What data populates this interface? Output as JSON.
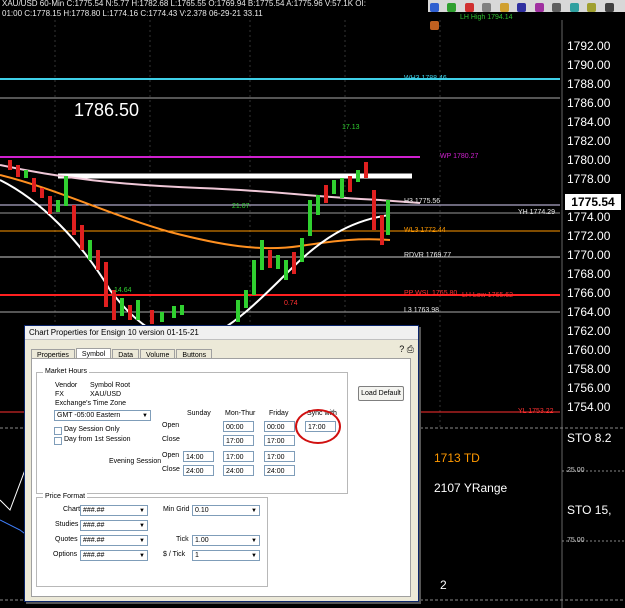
{
  "header": {
    "line1": "XAU/USD  60-Min  C:1775.54  N:5.77  H:1782.68  L:1765.55  O:1769.94  B:1775.54  A:1775.96  V:57.1K  OI:",
    "line2": "01:00  C:1778.15  H:1778.80  L:1774.16  C:1774.43  V:2.378  06-29-21  33.11"
  },
  "axis_prices": [
    "1792.00",
    "1790.00",
    "1788.00",
    "1786.00",
    "1784.00",
    "1782.00",
    "1780.00",
    "1778.00",
    "1776.00",
    "1774.00",
    "1772.00",
    "1770.00",
    "1768.00",
    "1766.00",
    "1764.00",
    "1762.00",
    "1760.00",
    "1758.00",
    "1756.00",
    "1754.00"
  ],
  "current_price": "1775.54",
  "big_price": "1786.50",
  "levels": {
    "wh3": "WH3 1788.46",
    "wp": "WP 1780.27",
    "h3": "H3 1775.56",
    "yh": "YH 1774.29",
    "wl3": "WL3 1772.44",
    "rdvr": "RDVR 1769.77",
    "pp": "PP WSL 1765.80",
    "lh_low": "LH Low 1765.62",
    "l3": "L3 1763.98",
    "yl": "YL 1753.22",
    "lh_high": "LH High 1794.14"
  },
  "chart_annotations": [
    "17.13",
    "21.07",
    "14.64",
    "0.74"
  ],
  "right_panel": {
    "td_label": "1713 TD",
    "yrange_label": "2107 YRange",
    "sto_label": "STO  15,",
    "sto_top": "STO  8.2",
    "sto_25": "25.00",
    "sto_75": "75.00",
    "page": "2"
  },
  "dialog": {
    "title": "Chart Properties for Ensign 10 version 01-15-21",
    "tabs": [
      "Properties",
      "Symbol",
      "Data",
      "Volume",
      "Buttons"
    ],
    "help_icon": "?",
    "market_hours": {
      "group_label": "Market Hours",
      "vendor_label": "Vendor",
      "vendor_value": "FX",
      "symbol_root_label": "Symbol Root",
      "symbol_root_value": "XAU/USD",
      "tz_label": "Exchange's Time Zone",
      "tz_value": "GMT -05:00  Eastern",
      "day_session_only": "Day Session Only",
      "day_from_first": "Day from 1st Session",
      "col_sunday": "Sunday",
      "col_monthur": "Mon-Thur",
      "col_friday": "Friday",
      "col_sync": "Sync with",
      "row_open": "Open",
      "row_close": "Close",
      "evening_label": "Evening Session",
      "day_open": [
        "",
        "00:00",
        "00:00"
      ],
      "day_close": [
        "",
        "17:00",
        "17:00"
      ],
      "eve_open": [
        "14:00",
        "17:00",
        "17:00"
      ],
      "eve_close": [
        "24:00",
        "24:00",
        "24:00"
      ],
      "sync_value": "17:00",
      "load_default": "Load Default"
    },
    "price_format": {
      "group_label": "Price Format",
      "chart_label": "Chart",
      "chart_value": "###.##",
      "studies_label": "Studies",
      "studies_value": "###.##",
      "quotes_label": "Quotes",
      "quotes_value": "###.##",
      "options_label": "Options",
      "options_value": "###.##",
      "mingrid_label": "Min Grid",
      "mingrid_value": "0.10",
      "tick_label": "Tick",
      "tick_value": "1.00",
      "dollar_tick_label": "$ / Tick",
      "dollar_tick_value": "1"
    }
  }
}
